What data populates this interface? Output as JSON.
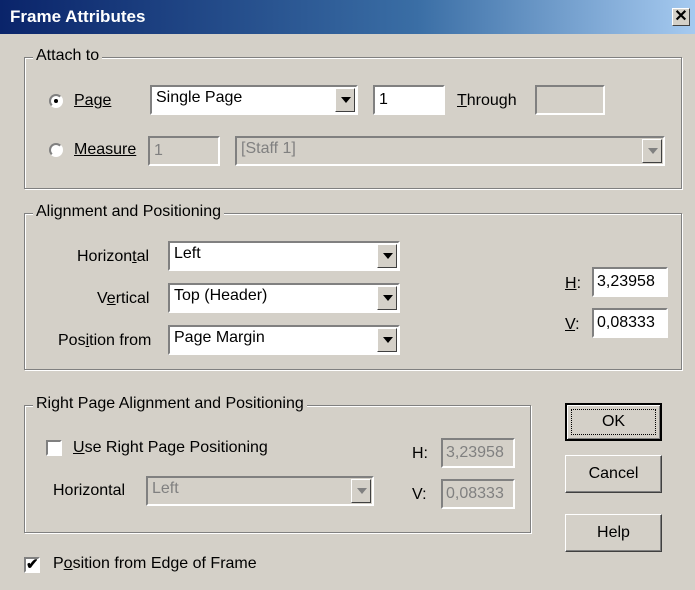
{
  "window": {
    "title": "Frame Attributes",
    "close_glyph": "✕"
  },
  "attach": {
    "legend": "Attach to",
    "page": {
      "label": "Page",
      "selected": true,
      "page_type": "Single Page",
      "from": "1",
      "through_label": "Through",
      "through": ""
    },
    "measure": {
      "label": "Measure",
      "selected": false,
      "measure": "1",
      "staff": "[Staff 1]"
    }
  },
  "alignment": {
    "legend": "Alignment and Positioning",
    "horizontal": {
      "label": "Horizontal",
      "value": "Left"
    },
    "vertical": {
      "label": "Vertical",
      "value": "Top (Header)"
    },
    "position_from": {
      "label": "Position from",
      "value": "Page Margin"
    },
    "h": {
      "label": "H:",
      "value": "3,23958"
    },
    "v": {
      "label": "V:",
      "value": "0,08333"
    }
  },
  "right_page": {
    "legend": "Right Page Alignment and Positioning",
    "use_label": "Use Right Page Positioning",
    "use_checked": false,
    "horizontal": {
      "label": "Horizontal",
      "value": "Left"
    },
    "h": {
      "label": "H:",
      "value": "3,23958"
    },
    "v": {
      "label": "V:",
      "value": "0,08333"
    }
  },
  "edge": {
    "label": "Position from Edge of Frame",
    "checked": true,
    "check_glyph": "✔"
  },
  "buttons": {
    "ok": "OK",
    "cancel": "Cancel",
    "help": "Help"
  }
}
